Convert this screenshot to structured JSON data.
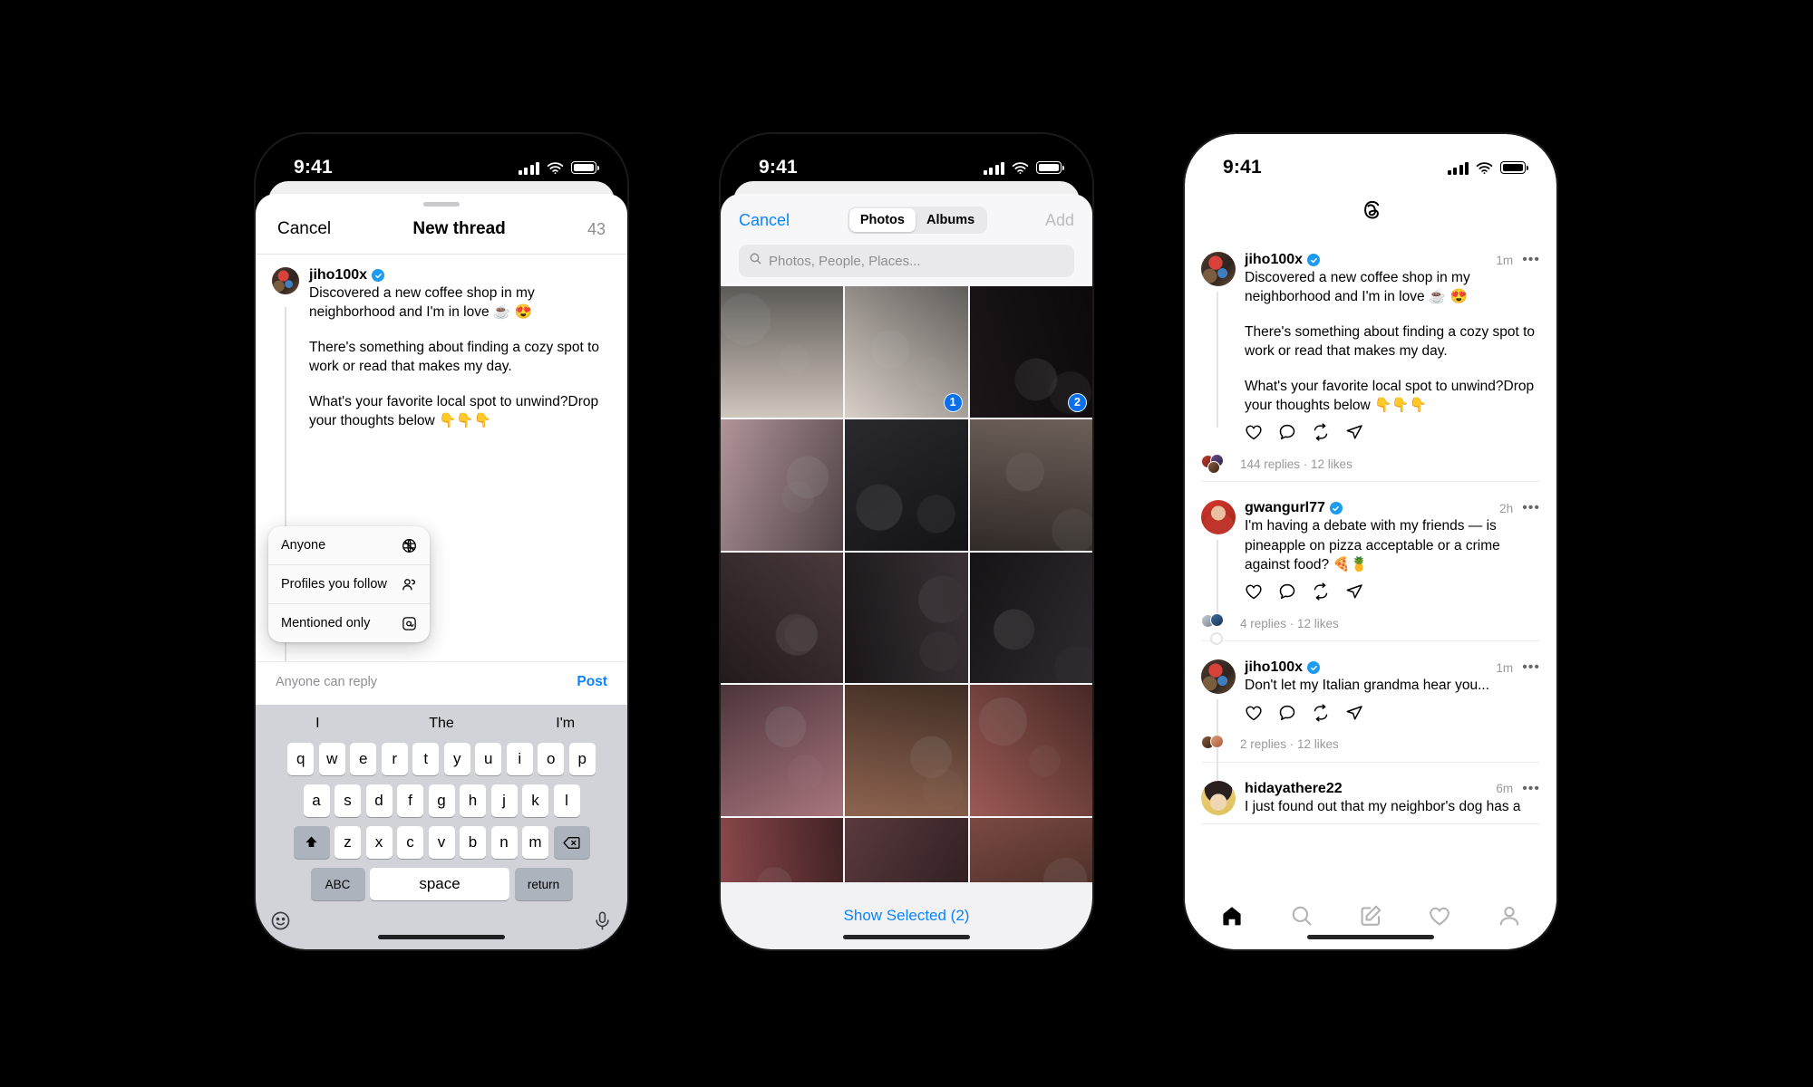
{
  "status_bar": {
    "time": "9:41"
  },
  "composer": {
    "cancel_label": "Cancel",
    "title": "New thread",
    "char_count": "43",
    "username": "jiho100x",
    "paragraph_1": "Discovered a new coffee shop in my neighborhood and I'm in love ☕ 😍",
    "paragraph_2": "There's something about finding a cozy spot to work or read that makes my day.",
    "paragraph_3": "What's your favorite local spot to unwind?Drop your thoughts below 👇👇👇",
    "reply_note": "Anyone can reply",
    "post_label": "Post",
    "audience_menu": {
      "items": [
        {
          "label": "Anyone",
          "icon": "globe-icon"
        },
        {
          "label": "Profiles you follow",
          "icon": "people-icon"
        },
        {
          "label": "Mentioned only",
          "icon": "at-icon"
        }
      ]
    },
    "keyboard": {
      "predictions": [
        "I",
        "The",
        "I'm"
      ],
      "row1": [
        "q",
        "w",
        "e",
        "r",
        "t",
        "y",
        "u",
        "i",
        "o",
        "p"
      ],
      "row2": [
        "a",
        "s",
        "d",
        "f",
        "g",
        "h",
        "j",
        "k",
        "l"
      ],
      "row3": [
        "z",
        "x",
        "c",
        "v",
        "b",
        "n",
        "m"
      ],
      "shift_icon": "shift-icon",
      "backspace_icon": "backspace-icon",
      "abc_label": "ABC",
      "space_label": "space",
      "return_label": "return",
      "emoji_icon": "emoji-icon",
      "mic_icon": "microphone-icon"
    }
  },
  "photo_picker": {
    "cancel_label": "Cancel",
    "add_label": "Add",
    "segments": [
      {
        "label": "Photos",
        "selected": true
      },
      {
        "label": "Albums",
        "selected": false
      }
    ],
    "search_placeholder": "Photos, People, Places...",
    "show_selected_label": "Show Selected (2)",
    "selection_badges": [
      "1",
      "2"
    ],
    "grid": [
      [
        {
          "tone": "#cfc6bd",
          "badge": null
        },
        {
          "tone": "#d8cfc8",
          "badge": "1"
        },
        {
          "tone": "#1c1518",
          "badge": "2"
        }
      ],
      [
        {
          "tone": "#b09498",
          "badge": null
        },
        {
          "tone": "#2a2a2e",
          "badge": null
        },
        {
          "tone": "#6c5f58",
          "badge": null
        }
      ],
      [
        {
          "tone": "#4a3a3c",
          "badge": null
        },
        {
          "tone": "#3a3236",
          "badge": null
        },
        {
          "tone": "#2f2a2e",
          "badge": null
        }
      ],
      [
        {
          "tone": "#a8757e",
          "badge": null
        },
        {
          "tone": "#8e6450",
          "badge": null
        },
        {
          "tone": "#9c5a54",
          "badge": null
        }
      ],
      [
        {
          "tone": "#8f4a4e",
          "badge": null
        },
        {
          "tone": "#5a3a3e",
          "badge": null
        },
        {
          "tone": "#7a4a42",
          "badge": null
        }
      ]
    ]
  },
  "feed": {
    "logo_icon": "threads-logo-icon",
    "posts": [
      {
        "username": "jiho100x",
        "verified": true,
        "time": "1m",
        "avatar_class": "av-jiho",
        "paragraphs": [
          "Discovered a new coffee shop in my neighborhood and I'm in love ☕ 😍",
          "There's something about finding a cozy spot to work or read that makes my day.",
          "What's your favorite local spot to unwind?Drop your thoughts below 👇👇👇"
        ],
        "stats": "144 replies · 12 likes",
        "has_actions": true
      },
      {
        "username": "gwangurl77",
        "verified": true,
        "time": "2h",
        "avatar_class": "av-gwan",
        "paragraphs": [
          "I'm having a debate with my friends — is pineapple on pizza acceptable or a crime against food? 🍕🍍"
        ],
        "stats": "4 replies · 12 likes",
        "has_actions": true
      },
      {
        "username": "jiho100x",
        "verified": true,
        "time": "1m",
        "avatar_class": "av-jiho",
        "paragraphs": [
          "Don't let my Italian grandma hear you..."
        ],
        "stats": "2 replies · 12 likes",
        "has_actions": true
      },
      {
        "username": "hidayathere22",
        "verified": false,
        "time": "6m",
        "avatar_class": "av-hid",
        "paragraphs": [
          "I just found out that my neighbor's dog has a"
        ],
        "stats": "",
        "has_actions": false
      }
    ],
    "action_icons": [
      "like-icon",
      "comment-icon",
      "repost-icon",
      "share-icon"
    ],
    "tabs": [
      {
        "icon": "home-icon",
        "active": true
      },
      {
        "icon": "search-icon",
        "active": false
      },
      {
        "icon": "compose-icon",
        "active": false
      },
      {
        "icon": "activity-icon",
        "active": false
      },
      {
        "icon": "profile-icon",
        "active": false
      }
    ]
  },
  "colors": {
    "accent_blue": "#0a84ff",
    "badge_blue": "#0a6fe8",
    "verified_blue": "#1d9bf0",
    "background": "#000000"
  }
}
